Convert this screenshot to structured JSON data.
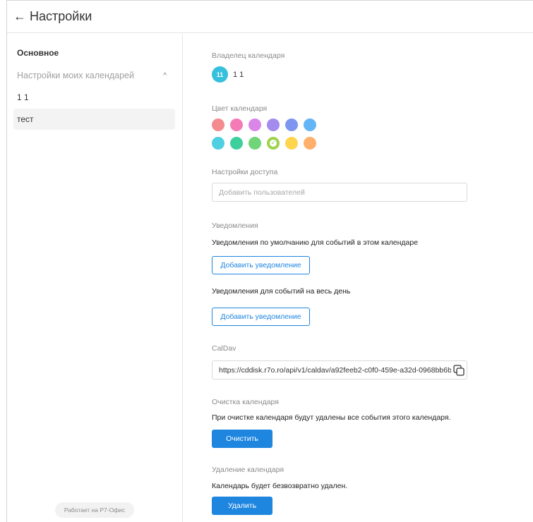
{
  "header": {
    "back_glyph": "←",
    "title": "Настройки"
  },
  "sidebar": {
    "heading": "Основное",
    "group_label": "Настройки моих календарей",
    "group_chevron": "^",
    "items": [
      {
        "label": "1 1",
        "active": false
      },
      {
        "label": "тест",
        "active": true
      }
    ],
    "powered_by": "Работает на Р7-Офис"
  },
  "owner": {
    "label": "Владелец календаря",
    "avatar_initials": "11",
    "name": "1 1"
  },
  "calendar_color": {
    "label": "Цвет календаря",
    "colors": [
      "#f48c8f",
      "#f57bb7",
      "#da86e8",
      "#a48bee",
      "#7d96ef",
      "#64b5f6",
      "#4fcfe2",
      "#3ecf9e",
      "#70d479",
      "#9fd34e",
      "#ffd54f",
      "#ffb06a"
    ],
    "selected_index": 9
  },
  "access": {
    "label": "Настройки доступа",
    "placeholder": "Добавить пользователей"
  },
  "notifications": {
    "label": "Уведомления",
    "default_text": "Уведомления по умолчанию для событий в этом календаре",
    "default_button": "Добавить уведомление",
    "allday_text": "Уведомления для событий на весь день",
    "allday_button": "Добавить уведомление"
  },
  "caldav": {
    "label": "CalDav",
    "url": "https://cddisk.r7o.ro/api/v1/caldav/a92feeb2-c0f0-459e-a32d-0968bb6b"
  },
  "clear": {
    "label": "Очистка календаря",
    "description": "При очистке календаря будут удалены все события этого календаря.",
    "button": "Очистить"
  },
  "delete": {
    "label": "Удаление календаря",
    "description": "Календарь будет безвозвратно удален.",
    "button": "Удалить"
  },
  "accent_color": "#1f86e0"
}
